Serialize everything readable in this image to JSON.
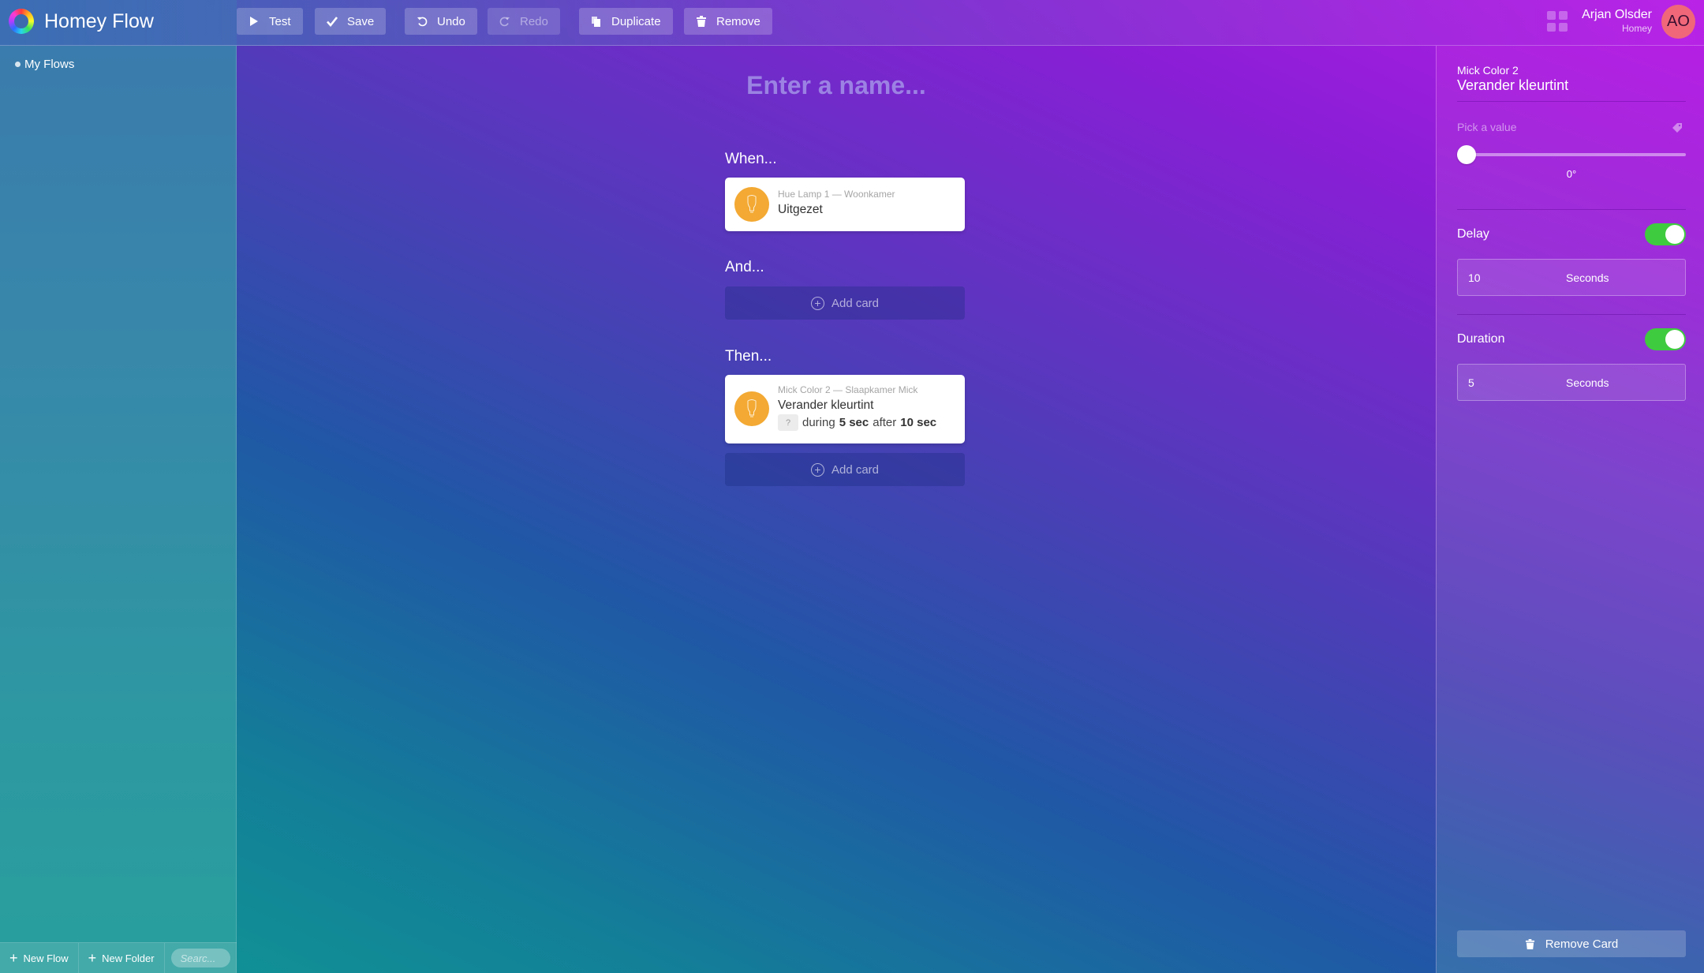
{
  "app": {
    "title": "Homey Flow"
  },
  "toolbar": {
    "buttons": [
      {
        "label": "Test",
        "icon": "play-icon",
        "enabled": true
      },
      {
        "label": "Save",
        "icon": "check-icon",
        "enabled": true
      },
      {
        "label": "Undo",
        "icon": "undo-icon",
        "enabled": true
      },
      {
        "label": "Redo",
        "icon": "redo-icon",
        "enabled": false
      },
      {
        "label": "Duplicate",
        "icon": "duplicate-icon",
        "enabled": true
      },
      {
        "label": "Remove",
        "icon": "trash-icon",
        "enabled": true
      }
    ]
  },
  "user": {
    "name": "Arjan Olsder",
    "subtitle": "Homey",
    "initials": "AO",
    "avatar_color": "#f0677a"
  },
  "sidebar": {
    "items": [
      {
        "label": "My Flows"
      }
    ],
    "footer": {
      "new_flow": "New Flow",
      "new_folder": "New Folder",
      "search_placeholder": "Searc..."
    }
  },
  "flow": {
    "name_placeholder": "Enter a name...",
    "sections": {
      "when": "When...",
      "and": "And...",
      "then": "Then..."
    },
    "add_card_label": "Add card",
    "when_card": {
      "owner": "Hue Lamp 1 — Woonkamer",
      "title": "Uitgezet",
      "icon": "lightbulb-icon"
    },
    "then_card": {
      "owner": "Mick Color 2 — Slaapkamer Mick",
      "title": "Verander kleurtint",
      "placeholder_arg": "?",
      "during_word": "during",
      "duration": "5 sec",
      "after_word": "after",
      "delay": "10 sec",
      "icon": "lightbulb-icon"
    }
  },
  "panel": {
    "owner": "Mick Color 2",
    "title": "Verander kleurtint",
    "pick_label": "Pick a value",
    "slider_value": 0,
    "slider_max": 360,
    "slider_display": "0°",
    "delay": {
      "label": "Delay",
      "enabled": true,
      "value": "10",
      "unit": "Seconds"
    },
    "duration": {
      "label": "Duration",
      "enabled": true,
      "value": "5",
      "unit": "Seconds"
    },
    "remove_label": "Remove Card"
  },
  "colors": {
    "toggle_on": "#3fcb3f",
    "card_icon": "#f3a933"
  }
}
